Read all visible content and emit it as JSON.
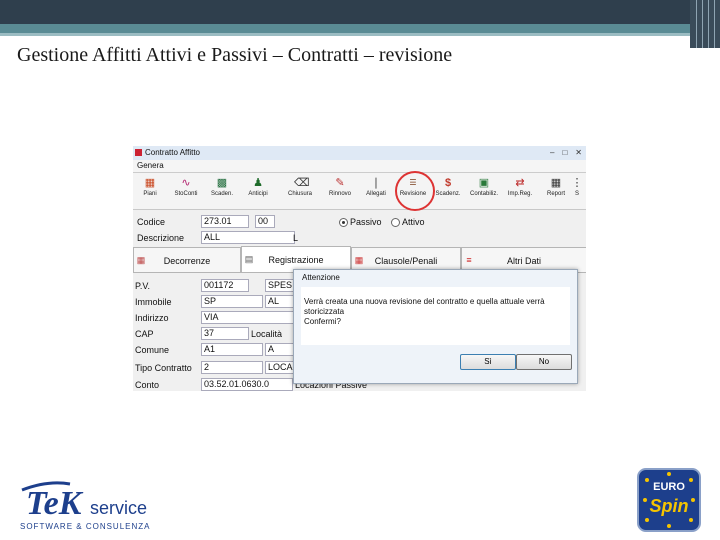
{
  "slide": {
    "title": "Gestione Affitti Attivi e Passivi – Contratti – revisione"
  },
  "window": {
    "title": "Contratto Affitto",
    "menu": "Genera",
    "toolbar": [
      {
        "label": "Piani",
        "icon": "plan-icon"
      },
      {
        "label": "StoConti",
        "icon": "chart-icon"
      },
      {
        "label": "Scaden.",
        "icon": "calendar-icon"
      },
      {
        "label": "Anticipi",
        "icon": "person-icon"
      },
      {
        "label": "Chiusura",
        "icon": "close-contract-icon"
      },
      {
        "label": "Rinnovo",
        "icon": "renew-icon"
      },
      {
        "label": "Allegati",
        "icon": "attachment-icon"
      },
      {
        "label": "Revisione",
        "icon": "revision-icon"
      },
      {
        "label": "Scadenz.",
        "icon": "dollar-icon"
      },
      {
        "label": "Contabiliz.",
        "icon": "car-icon"
      },
      {
        "label": "Imp.Reg.",
        "icon": "register-icon"
      },
      {
        "label": "Report",
        "icon": "report-icon"
      },
      {
        "label": "S",
        "icon": "more-icon"
      }
    ],
    "form": {
      "codice_label": "Codice",
      "codice_value": "273.01",
      "codice_suffix": "00",
      "passivo_label": "Passivo",
      "attivo_label": "Attivo",
      "descrizione_label": "Descrizione",
      "descrizione_value": "ALL",
      "descrizione_suffix": "L"
    },
    "tabs": [
      {
        "label": "Decorrenze"
      },
      {
        "label": "Registrazione"
      },
      {
        "label": "Clausole/Penali"
      },
      {
        "label": "Altri Dati"
      }
    ],
    "fields": [
      {
        "label": "P.V.",
        "value": "001172",
        "extra": "SPES"
      },
      {
        "label": "Immobile",
        "value": "SP",
        "extra": "AL"
      },
      {
        "label": "Indirizzo",
        "value": "VIA",
        "extra": ""
      },
      {
        "label": "CAP",
        "value": "37",
        "extra": "Località"
      },
      {
        "label": "Comune",
        "value": "A1",
        "extra": "A"
      },
      {
        "label": "Tipo Contratto",
        "value": "2",
        "extra": "LOCA"
      },
      {
        "label": "Conto",
        "value": "03.52.01.0630.0",
        "extra": "Locazioni Passive"
      }
    ]
  },
  "dialog": {
    "title": "Attenzione",
    "message": "Verrà creata una nuova revisione del contratto e quella attuale verrà storicizzata\nConfermi?",
    "yes": "Sì",
    "no": "No"
  },
  "logos": {
    "tek_main": "TeK",
    "tek_service": "service",
    "tek_sub": "SOFTWARE & CONSULENZA",
    "euro_top": "EURO",
    "euro_main": "Spin"
  },
  "colors": {
    "accent_ring": "#d33333",
    "header_dark": "#2f3f4d",
    "header_teal": "#5a8b94"
  }
}
